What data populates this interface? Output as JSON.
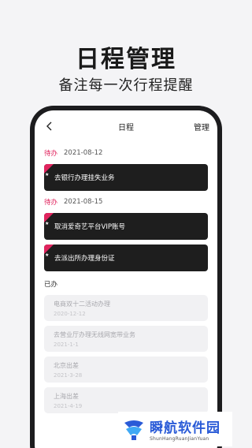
{
  "promo": {
    "title": "日程管理",
    "subtitle": "备注每一次行程提醒"
  },
  "nav": {
    "back_icon": "chevron-left-icon",
    "title": "日程",
    "manage_label": "管理"
  },
  "pending_groups": [
    {
      "status": "待办",
      "date": "2021-08-12",
      "tasks": [
        "去银行办理挂失业务"
      ]
    },
    {
      "status": "待办",
      "date": "2021-08-15",
      "tasks": [
        "取消爱奇艺平台VIP账号",
        "去派出所办理身份证"
      ]
    }
  ],
  "done": {
    "title": "已办",
    "items": [
      {
        "name": "电商双十二活动办理",
        "date": "2020-12-12"
      },
      {
        "name": "去营业厅办理无线网宽带业务",
        "date": "2021-1-1"
      },
      {
        "name": "北京出差",
        "date": "2021-3-28"
      },
      {
        "name": "上海出差",
        "date": "2021-4-19"
      }
    ]
  },
  "watermark": {
    "name": "瞬航软件园",
    "sub": "ShunHangRuanJianYuan"
  },
  "colors": {
    "accent": "#e0245e",
    "card_dark": "#1e1e1e",
    "phone_frame": "#1c1c1e",
    "watermark_blue": "#2a5bd7"
  }
}
